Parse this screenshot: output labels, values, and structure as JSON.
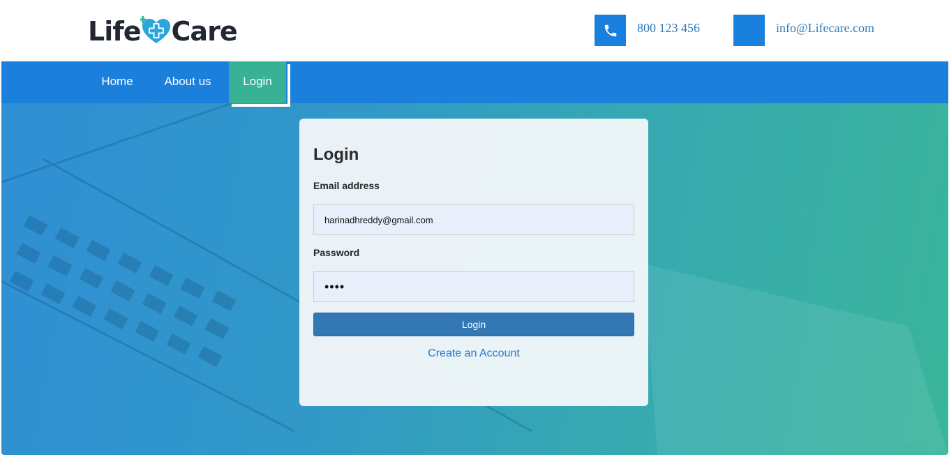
{
  "brand": {
    "part1": "Life",
    "part2": "Care"
  },
  "contact": {
    "phone": "800 123 456",
    "email": "info@Lifecare.com",
    "phone_icon": "phone-icon",
    "mail_icon": "mail-icon"
  },
  "nav": {
    "items": [
      {
        "label": "Home"
      },
      {
        "label": "About us"
      },
      {
        "label": "Login",
        "active": true
      }
    ]
  },
  "login_form": {
    "title": "Login",
    "email_label": "Email address",
    "email_value": "harinadhreddy@gmail.com",
    "password_label": "Password",
    "password_value": "••••",
    "submit_label": "Login",
    "create_account_label": "Create an Account"
  },
  "colors": {
    "primary": "#1a80dc",
    "accent": "#38b295",
    "button": "#3377b5",
    "link": "#1c7bd4"
  }
}
